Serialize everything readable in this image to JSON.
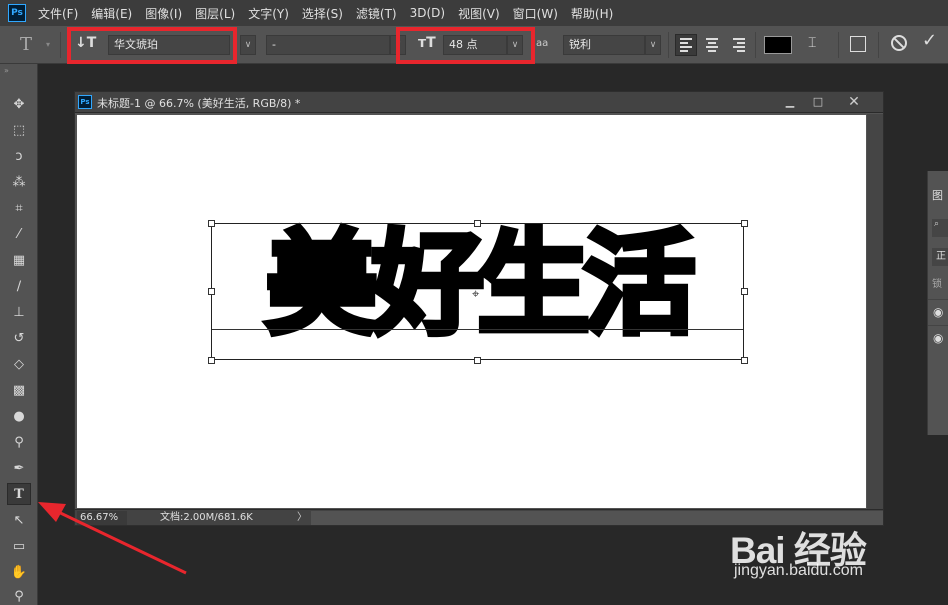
{
  "app": {
    "logo": "Ps"
  },
  "menu": [
    "文件(F)",
    "编辑(E)",
    "图像(I)",
    "图层(L)",
    "文字(Y)",
    "选择(S)",
    "滤镜(T)",
    "3D(D)",
    "视图(V)",
    "窗口(W)",
    "帮助(H)"
  ],
  "options": {
    "font_family": "华文琥珀",
    "font_style": "-",
    "font_size": "48 点",
    "anti_alias_icon": "aa",
    "anti_alias": "锐利",
    "text_color": "#000000"
  },
  "document": {
    "title": "未标题-1 @ 66.7% (美好生活, RGB/8) *",
    "zoom": "66.67%",
    "info": "文档:2.00M/681.6K",
    "canvas_text": "美好生活"
  },
  "layers_panel": {
    "tab": "图",
    "mode": "正",
    "lock": "锁"
  },
  "watermark": {
    "logo": "Bai 经验",
    "url": "jingyan.baidu.com"
  },
  "accent": {
    "highlight": "#e8262d",
    "arrow": "#e8262d"
  }
}
